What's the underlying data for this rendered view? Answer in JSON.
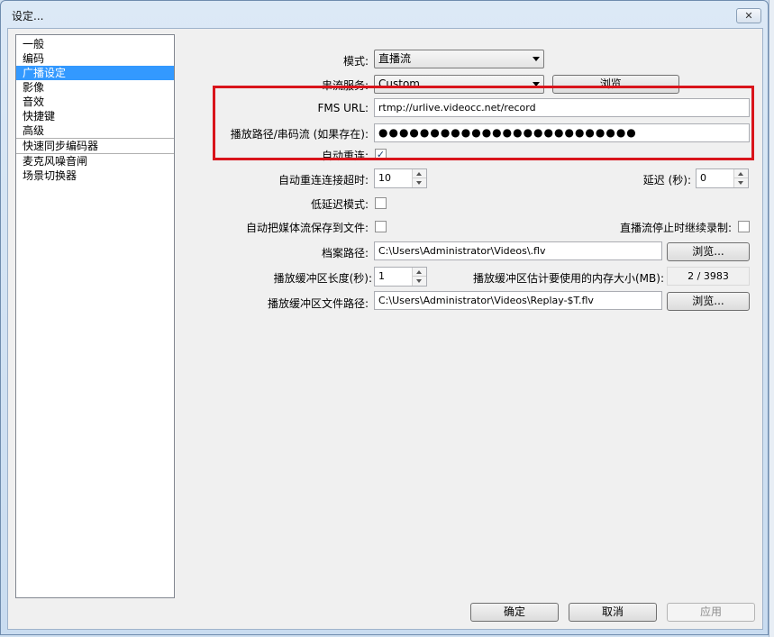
{
  "window": {
    "title": "设定...",
    "close": "✕"
  },
  "sidebar": {
    "items": [
      {
        "label": "一般"
      },
      {
        "label": "编码"
      },
      {
        "label": "广播设定",
        "selected": true
      },
      {
        "label": "影像"
      },
      {
        "label": "音效"
      },
      {
        "label": "快捷键"
      },
      {
        "label": "高级"
      },
      {
        "label": "快速同步编码器"
      },
      {
        "label": "麦克风噪音闸"
      },
      {
        "label": "场景切换器"
      }
    ]
  },
  "form": {
    "mode_label": "模式:",
    "mode_value": "直播流",
    "service_label": "串流服务:",
    "service_value": "Custom",
    "browse_label": "浏览...",
    "fms_url_label": "FMS URL:",
    "fms_url_value": "rtmp://urlive.videocc.net/record",
    "stream_key_label": "播放路径/串码流 (如果存在):",
    "stream_key_value": "●●●●●●●●●●●●●●●●●●●●●●●●●",
    "auto_reconnect_label": "自动重连:",
    "auto_reconnect_check": "✓",
    "reconnect_timeout_label": "自动重连连接超时:",
    "reconnect_timeout_value": "10",
    "delay_label": "延迟 (秒):",
    "delay_value": "0",
    "low_latency_label": "低延迟模式:",
    "save_to_file_label": "自动把媒体流保存到文件:",
    "keep_recording_label": "直播流停止时继续录制:",
    "file_path_label": "档案路径:",
    "file_path_value": "C:\\Users\\Administrator\\Videos\\.flv",
    "file_browse_label": "浏览...",
    "buffer_length_label": "播放缓冲区长度(秒):",
    "buffer_length_value": "1",
    "buffer_memory_label": "播放缓冲区估计要使用的内存大小(MB):",
    "buffer_memory_value": "2 / 3983",
    "buffer_path_label": "播放缓冲区文件路径:",
    "buffer_path_value": "C:\\Users\\Administrator\\Videos\\Replay-$T.flv",
    "buffer_browse_label": "浏览..."
  },
  "footer": {
    "ok_label": "确定",
    "cancel_label": "取消",
    "apply_label": "应用"
  },
  "colors": {
    "highlight": "#d9141b",
    "selection": "#3399ff"
  }
}
